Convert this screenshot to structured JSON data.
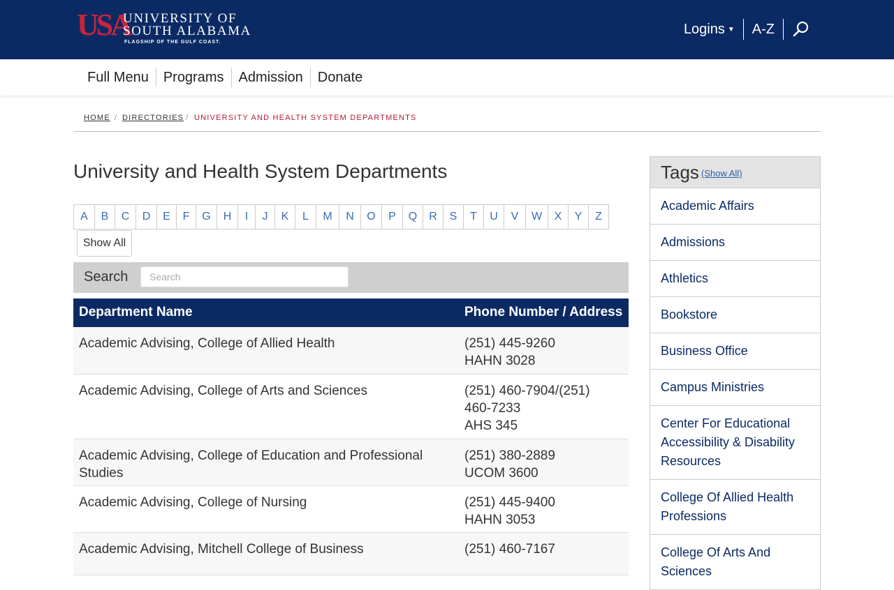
{
  "header": {
    "logo_mark": "USA",
    "logo_line1": "UNIVERSITY OF",
    "logo_line2": "SOUTH ALABAMA",
    "logo_tagline": "FLAGSHIP OF THE GULF COAST.",
    "logins_label": "Logins",
    "az_label": "A-Z"
  },
  "nav": {
    "items": [
      "Full Menu",
      "Programs",
      "Admission",
      "Donate"
    ]
  },
  "breadcrumb": {
    "home": "Home",
    "directories": "Directories",
    "current": "University and Health System Departments",
    "sep": "/"
  },
  "page": {
    "title": "University and Health System Departments",
    "letters": [
      "A",
      "B",
      "C",
      "D",
      "E",
      "F",
      "G",
      "H",
      "I",
      "J",
      "K",
      "L",
      "M",
      "N",
      "O",
      "P",
      "Q",
      "R",
      "S",
      "T",
      "U",
      "V",
      "W",
      "X",
      "Y",
      "Z"
    ],
    "show_all": "Show All",
    "search_label": "Search",
    "search_placeholder": "Search"
  },
  "table": {
    "col_name": "Department Name",
    "col_phone": "Phone Number / Address",
    "rows": [
      {
        "name": "Academic Advising, College of Allied Health",
        "phone": "(251) 445-9260",
        "address": "HAHN 3028"
      },
      {
        "name": "Academic Advising, College of Arts and Sciences",
        "phone": "(251) 460-7904/(251) 460-7233",
        "address": "AHS 345"
      },
      {
        "name": "Academic Advising, College of Education and Professional Studies",
        "phone": "(251) 380-2889",
        "address": "UCOM 3600"
      },
      {
        "name": "Academic Advising, College of Nursing",
        "phone": "(251) 445-9400",
        "address": "HAHN 3053"
      },
      {
        "name": "Academic Advising, Mitchell College of Business",
        "phone": "(251) 460-7167",
        "address": ""
      }
    ]
  },
  "tags": {
    "title": "Tags",
    "show_all": "(Show All)",
    "items": [
      "Academic Affairs",
      "Admissions",
      "Athletics",
      "Bookstore",
      "Business Office",
      "Campus Ministries",
      "Center For Educational Accessibility & Disability Resources",
      "College Of Allied Health Professions",
      "College Of Arts And Sciences"
    ]
  },
  "colors": {
    "navy": "#0b2a64",
    "red": "#b5193c",
    "link_blue": "#3a6ab5"
  }
}
